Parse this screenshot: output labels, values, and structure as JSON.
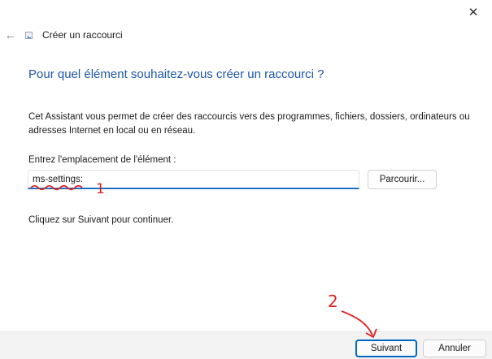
{
  "window": {
    "title": "Créer un raccourci",
    "close_icon": "close-icon",
    "back_icon": "back-arrow-icon",
    "app_icon": "shortcut-icon"
  },
  "main": {
    "heading": "Pour quel élément souhaitez-vous créer un raccourci ?",
    "description": "Cet Assistant vous permet de créer des raccourcis vers des programmes, fichiers, dossiers, ordinateurs ou adresses Internet en local ou en réseau.",
    "location_label": "Entrez l'emplacement de l'élément :",
    "location_value": "ms-settings:",
    "browse_label": "Parcourir...",
    "hint": "Cliquez sur Suivant pour continuer."
  },
  "footer": {
    "next_label": "Suivant",
    "cancel_label": "Annuler"
  },
  "annotations": {
    "marker_1": "1",
    "marker_2": "2",
    "color": "#e02020"
  },
  "colors": {
    "heading": "#1d56a8",
    "accent": "#0067c0"
  }
}
